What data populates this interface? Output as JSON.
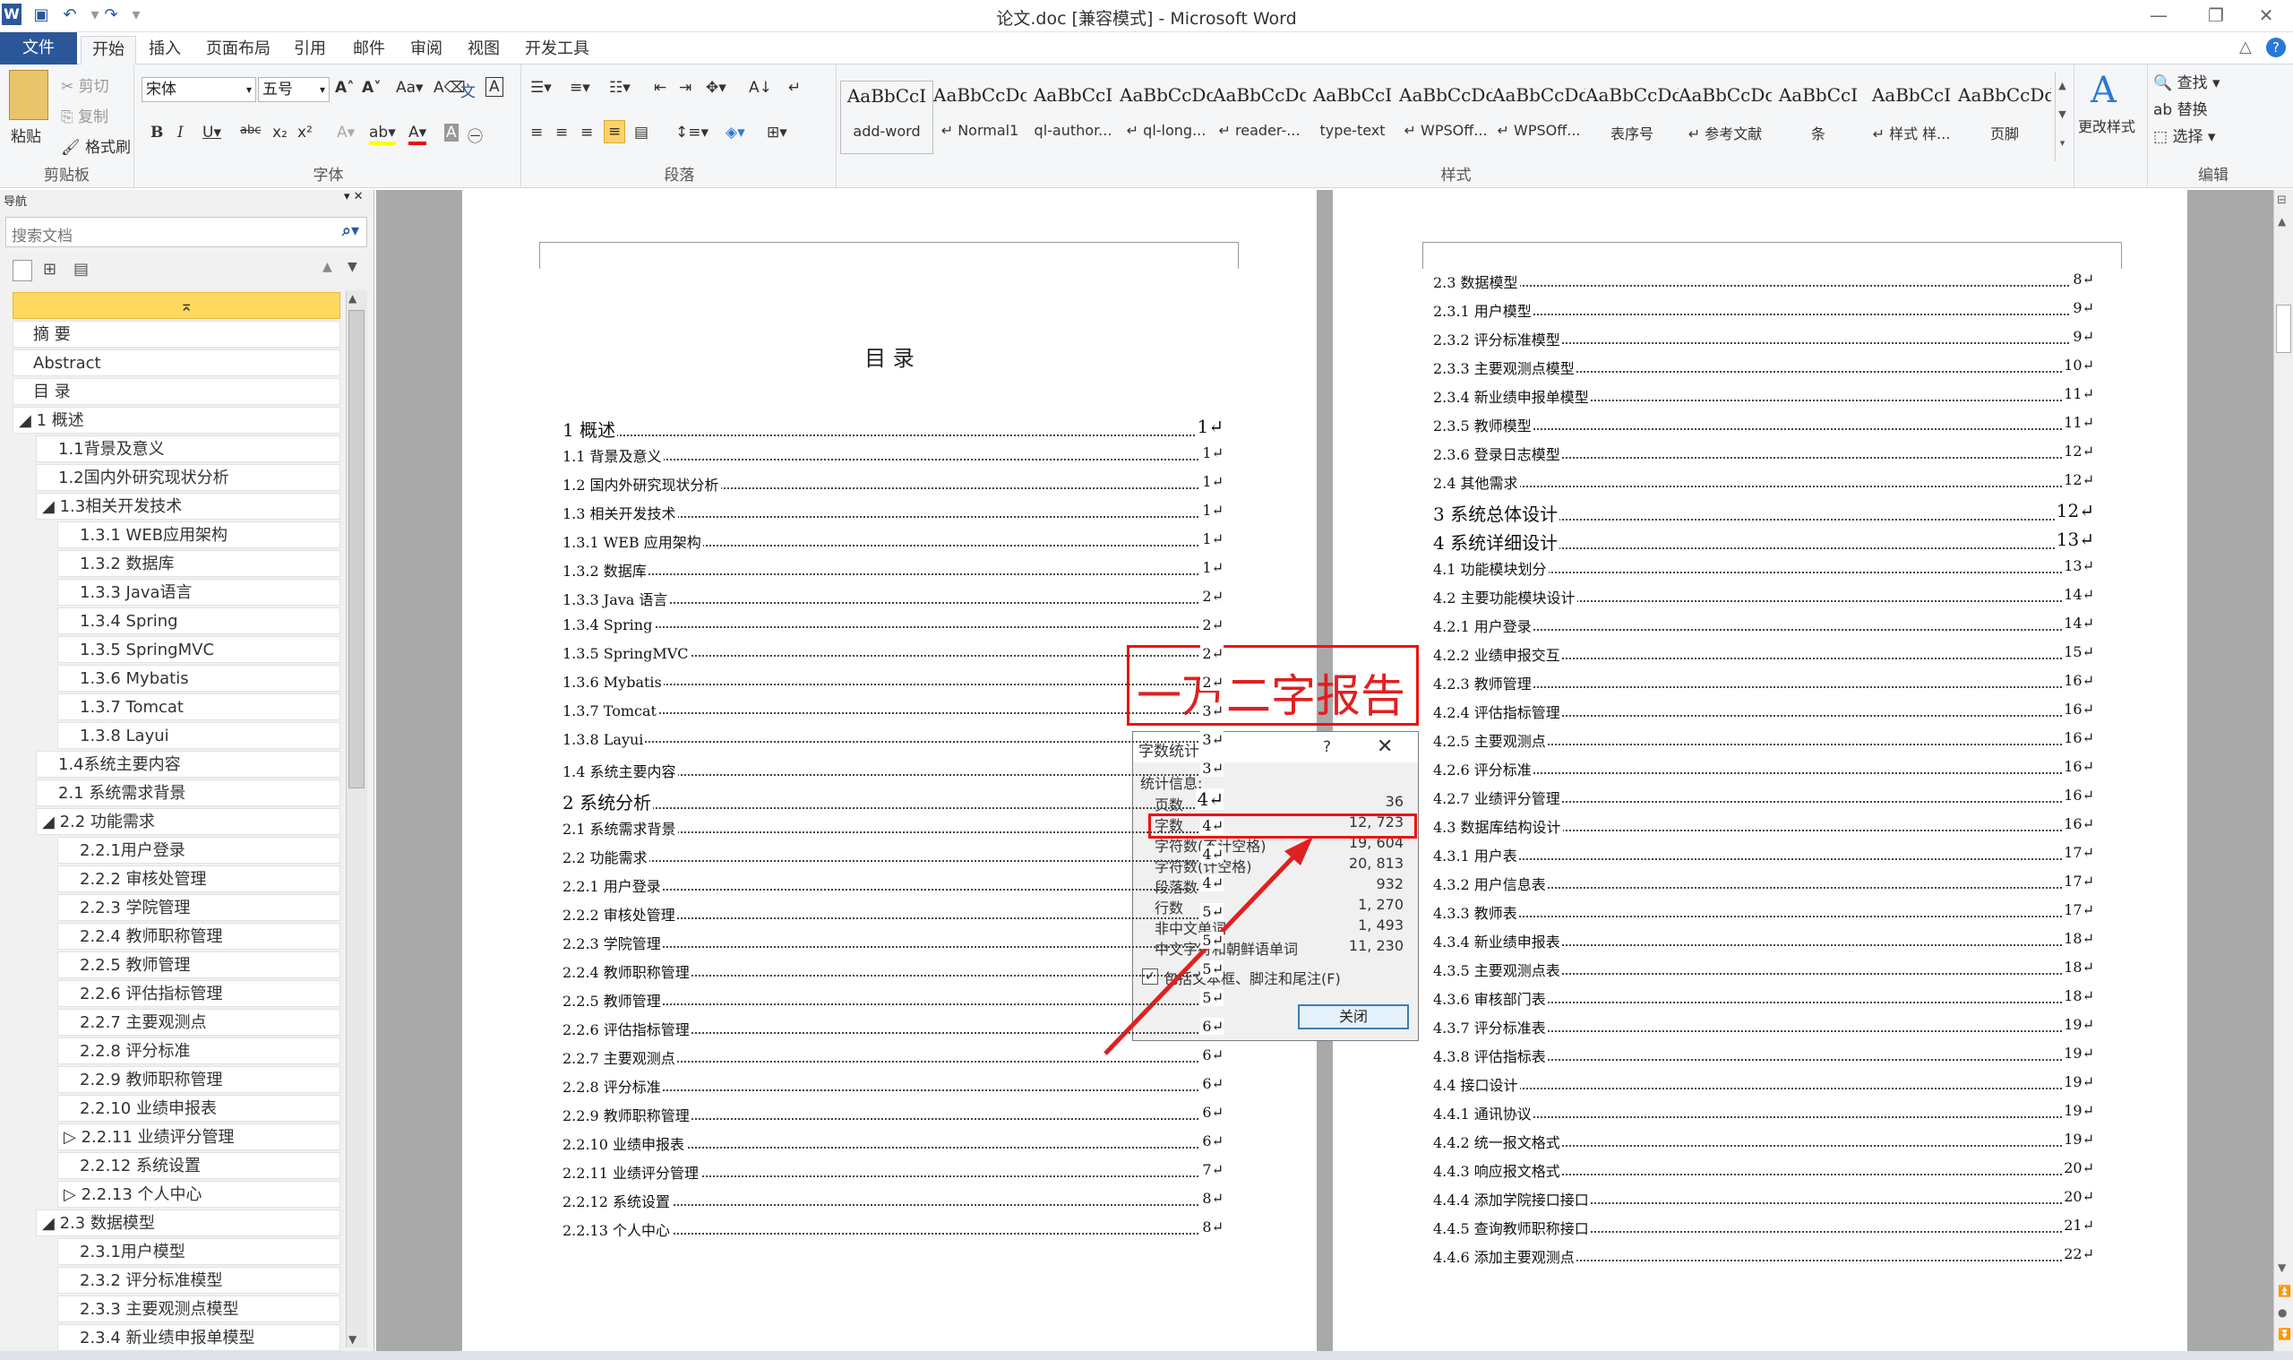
{
  "window": {
    "title": "论文.doc [兼容模式] - Microsoft Word"
  },
  "quick_access": [
    "save-icon",
    "undo-icon",
    "redo-icon"
  ],
  "tabs": [
    "文件",
    "开始",
    "插入",
    "页面布局",
    "引用",
    "邮件",
    "审阅",
    "视图",
    "开发工具"
  ],
  "ribbon": {
    "clipboard": {
      "paste": "粘贴",
      "cut": "剪切",
      "copy": "复制",
      "format_painter": "格式刷",
      "label": "剪贴板"
    },
    "font": {
      "name": "宋体",
      "size": "五号",
      "label": "字体"
    },
    "paragraph": {
      "label": "段落"
    },
    "styles": {
      "label": "样式",
      "change": "更改样式",
      "items": [
        {
          "sample": "AaBbCcI",
          "name": "add-word"
        },
        {
          "sample": "AaBbCcDc",
          "name": "↵ Normal1"
        },
        {
          "sample": "AaBbCcI",
          "name": "ql-author..."
        },
        {
          "sample": "AaBbCcDc",
          "name": "↵ ql-long..."
        },
        {
          "sample": "AaBbCcDc",
          "name": "↵ reader-..."
        },
        {
          "sample": "AaBbCcI",
          "name": "type-text"
        },
        {
          "sample": "AaBbCcDd",
          "name": "↵ WPSOff..."
        },
        {
          "sample": "AaBbCcDd",
          "name": "↵ WPSOff..."
        },
        {
          "sample": "AaBbCcDdI",
          "name": "表序号"
        },
        {
          "sample": "AaBbCcDc",
          "name": "↵ 参考文献"
        },
        {
          "sample": "AaBbCcI",
          "name": "条"
        },
        {
          "sample": "AaBbCcI",
          "name": "↵ 样式 样..."
        },
        {
          "sample": "AaBbCcDdE",
          "name": "页脚"
        }
      ]
    },
    "editing": {
      "find": "查找",
      "replace": "替换",
      "select": "选择",
      "label": "编辑"
    }
  },
  "nav": {
    "title": "导航",
    "search_placeholder": "搜索文档",
    "items": [
      {
        "label": "",
        "level": 0,
        "sel": true
      },
      {
        "label": "摘  要",
        "level": 0
      },
      {
        "label": "Abstract",
        "level": 0
      },
      {
        "label": "目    录",
        "level": 0
      },
      {
        "label": "◢ 1 概述",
        "level": 0
      },
      {
        "label": "1.1背景及意义",
        "level": 1
      },
      {
        "label": "1.2国内外研究现状分析",
        "level": 1
      },
      {
        "label": "◢ 1.3相关开发技术",
        "level": 1
      },
      {
        "label": "1.3.1 WEB应用架构",
        "level": 2
      },
      {
        "label": "1.3.2 数据库",
        "level": 2
      },
      {
        "label": "1.3.3 Java语言",
        "level": 2
      },
      {
        "label": "1.3.4 Spring",
        "level": 2
      },
      {
        "label": "1.3.5 SpringMVC",
        "level": 2
      },
      {
        "label": "1.3.6 Mybatis",
        "level": 2
      },
      {
        "label": "1.3.7 Tomcat",
        "level": 2
      },
      {
        "label": "1.3.8 Layui",
        "level": 2
      },
      {
        "label": "1.4系统主要内容",
        "level": 1
      },
      {
        "label": "2.1 系统需求背景",
        "level": 1
      },
      {
        "label": "◢ 2.2 功能需求",
        "level": 1
      },
      {
        "label": "2.2.1用户登录",
        "level": 2
      },
      {
        "label": "2.2.2 审核处管理",
        "level": 2
      },
      {
        "label": "2.2.3 学院管理",
        "level": 2
      },
      {
        "label": "2.2.4 教师职称管理",
        "level": 2
      },
      {
        "label": "2.2.5 教师管理",
        "level": 2
      },
      {
        "label": "2.2.6 评估指标管理",
        "level": 2
      },
      {
        "label": "2.2.7 主要观测点",
        "level": 2
      },
      {
        "label": "2.2.8 评分标准",
        "level": 2
      },
      {
        "label": "2.2.9 教师职称管理",
        "level": 2
      },
      {
        "label": "2.2.10 业绩申报表",
        "level": 2
      },
      {
        "label": "▷ 2.2.11 业绩评分管理",
        "level": 2
      },
      {
        "label": "2.2.12 系统设置",
        "level": 2
      },
      {
        "label": "▷ 2.2.13 个人中心",
        "level": 2
      },
      {
        "label": "◢ 2.3 数据模型",
        "level": 1
      },
      {
        "label": "2.3.1用户模型",
        "level": 2
      },
      {
        "label": "2.3.2 评分标准模型",
        "level": 2
      },
      {
        "label": "2.3.3 主要观测点模型",
        "level": 2
      },
      {
        "label": "2.3.4 新业绩申报单模型",
        "level": 2
      }
    ]
  },
  "page1": {
    "heading": "目      录",
    "toc": [
      {
        "t": "1    概述",
        "p": "1",
        "big": true
      },
      {
        "t": "1.1  背景及意义",
        "p": "1"
      },
      {
        "t": "1.2  国内外研究现状分析",
        "p": "1"
      },
      {
        "t": "1.3  相关开发技术",
        "p": "1"
      },
      {
        "t": "1.3.1 WEB 应用架构",
        "p": "1"
      },
      {
        "t": "1.3.2 数据库",
        "p": "1"
      },
      {
        "t": "1.3.3 Java 语言",
        "p": "2"
      },
      {
        "t": "1.3.4 Spring",
        "p": "2"
      },
      {
        "t": "1.3.5 SpringMVC",
        "p": "2"
      },
      {
        "t": "1.3.6 Mybatis",
        "p": "2"
      },
      {
        "t": "1.3.7 Tomcat",
        "p": "3"
      },
      {
        "t": "1.3.8 Layui",
        "p": "3"
      },
      {
        "t": "1.4  系统主要内容",
        "p": "3"
      },
      {
        "t": "2    系统分析",
        "p": "4",
        "big": true
      },
      {
        "t": "2.1  系统需求背景",
        "p": "4"
      },
      {
        "t": "2.2  功能需求",
        "p": "4"
      },
      {
        "t": "2.2.1 用户登录",
        "p": "4"
      },
      {
        "t": "2.2.2 审核处管理",
        "p": "5"
      },
      {
        "t": "2.2.3 学院管理",
        "p": "5"
      },
      {
        "t": "2.2.4 教师职称管理",
        "p": "5"
      },
      {
        "t": "2.2.5 教师管理",
        "p": "5"
      },
      {
        "t": "2.2.6 评估指标管理",
        "p": "6"
      },
      {
        "t": "2.2.7 主要观测点",
        "p": "6"
      },
      {
        "t": "2.2.8 评分标准",
        "p": "6"
      },
      {
        "t": "2.2.9 教师职称管理",
        "p": "6"
      },
      {
        "t": "2.2.10 业绩申报表",
        "p": "6"
      },
      {
        "t": "2.2.11 业绩评分管理",
        "p": "7"
      },
      {
        "t": "2.2.12 系统设置",
        "p": "8"
      },
      {
        "t": "2.2.13 个人中心",
        "p": "8"
      }
    ]
  },
  "page2": {
    "toc": [
      {
        "t": "2.3  数据模型",
        "p": "8"
      },
      {
        "t": "2.3.1 用户模型",
        "p": "9"
      },
      {
        "t": "2.3.2 评分标准模型",
        "p": "9"
      },
      {
        "t": "2.3.3 主要观测点模型",
        "p": "10"
      },
      {
        "t": "2.3.4 新业绩申报单模型",
        "p": "11"
      },
      {
        "t": "2.3.5 教师模型",
        "p": "11"
      },
      {
        "t": "2.3.6 登录日志模型",
        "p": "12"
      },
      {
        "t": "2.4  其他需求",
        "p": "12"
      },
      {
        "t": "3    系统总体设计",
        "p": "12",
        "big": true
      },
      {
        "t": "4    系统详细设计",
        "p": "13",
        "big": true
      },
      {
        "t": "4.1  功能模块划分",
        "p": "13"
      },
      {
        "t": "4.2  主要功能模块设计",
        "p": "14"
      },
      {
        "t": "4.2.1 用户登录",
        "p": "14"
      },
      {
        "t": "4.2.2 业绩申报交互",
        "p": "15"
      },
      {
        "t": "4.2.3 教师管理",
        "p": "16"
      },
      {
        "t": "4.2.4 评估指标管理",
        "p": "16"
      },
      {
        "t": "4.2.5 主要观测点",
        "p": "16"
      },
      {
        "t": "4.2.6 评分标准",
        "p": "16"
      },
      {
        "t": "4.2.7 业绩评分管理",
        "p": "16"
      },
      {
        "t": "4.3  数据库结构设计",
        "p": "16"
      },
      {
        "t": "4.3.1 用户表",
        "p": "17"
      },
      {
        "t": "4.3.2 用户信息表",
        "p": "17"
      },
      {
        "t": "4.3.3 教师表",
        "p": "17"
      },
      {
        "t": "4.3.4 新业绩申报表",
        "p": "18"
      },
      {
        "t": "4.3.5 主要观测点表",
        "p": "18"
      },
      {
        "t": "4.3.6 审核部门表",
        "p": "18"
      },
      {
        "t": "4.3.7 评分标准表",
        "p": "19"
      },
      {
        "t": "4.3.8 评估指标表",
        "p": "19"
      },
      {
        "t": "4.4  接口设计",
        "p": "19"
      },
      {
        "t": "4.4.1 通讯协议",
        "p": "19"
      },
      {
        "t": "4.4.2 统一报文格式",
        "p": "19"
      },
      {
        "t": "4.4.3 响应报文格式",
        "p": "20"
      },
      {
        "t": "4.4.4 添加学院接口接口",
        "p": "20"
      },
      {
        "t": "4.4.5 查询教师职称接口",
        "p": "21"
      },
      {
        "t": "4.4.6 添加主要观测点",
        "p": "22"
      }
    ]
  },
  "annotation": {
    "text": "一万二字报告",
    "color": "#e02020"
  },
  "dialog": {
    "title": "字数统计",
    "help": "?",
    "section": "统计信息:",
    "rows": [
      {
        "k": "页数",
        "v": "36"
      },
      {
        "k": "字数",
        "v": "12, 723"
      },
      {
        "k": "字符数(不计空格)",
        "v": "19, 604"
      },
      {
        "k": "字符数(计空格)",
        "v": "20, 813"
      },
      {
        "k": "段落数",
        "v": "932"
      },
      {
        "k": "行数",
        "v": "1, 270"
      },
      {
        "k": "非中文单词",
        "v": "1, 493"
      },
      {
        "k": "中文字符和朝鲜语单词",
        "v": "11, 230"
      }
    ],
    "checkbox": "包括文本框、脚注和尾注(F)",
    "close": "关闭"
  }
}
